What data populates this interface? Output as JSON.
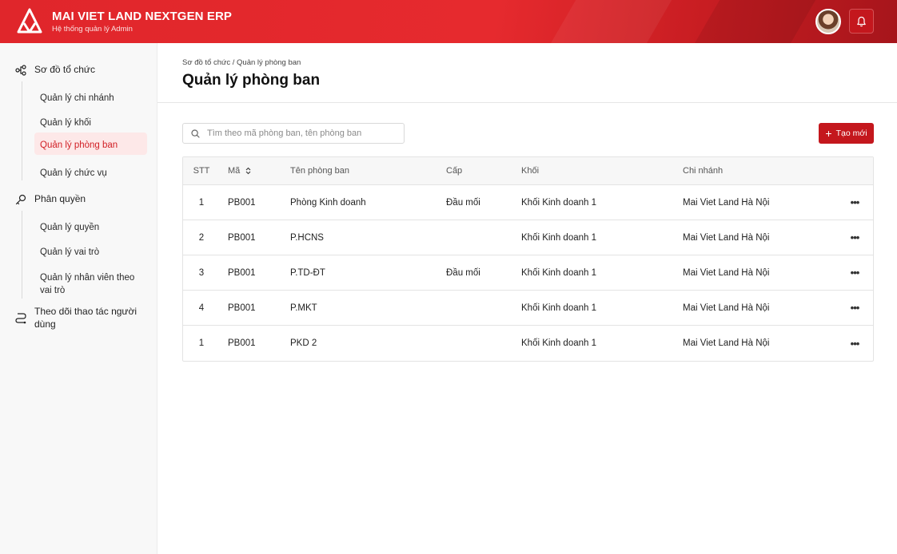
{
  "app": {
    "title": "MAI VIET LAND NEXTGEN ERP",
    "subtitle": "Hệ thống quản lý Admin"
  },
  "sidebar": {
    "groups": [
      {
        "label": "Sơ đồ tổ chức",
        "icon": "org-chart-icon",
        "items": [
          "Quản lý chi nhánh",
          "Quản lý khối",
          "Quản lý phòng ban",
          "Quản lý chức vụ"
        ]
      },
      {
        "label": "Phân quyền",
        "icon": "key-icon",
        "items": [
          "Quản lý quyền",
          "Quản lý vai trò",
          "Quản lý nhân viên theo vai trò"
        ]
      },
      {
        "label": "Theo dõi thao tác người dùng",
        "icon": "route-icon",
        "items": []
      }
    ],
    "active_item": "Quản lý phòng ban"
  },
  "main": {
    "breadcrumb": "Sơ đồ tổ chức / Quản lý phòng ban",
    "title": "Quản lý phòng ban",
    "search_placeholder": "Tìm theo mã phòng ban, tên phòng ban",
    "create_label": "Tạo mới"
  },
  "table": {
    "columns": [
      "STT",
      "Mã",
      "Tên phòng ban",
      "Cấp",
      "Khối",
      "Chi nhánh"
    ],
    "rows": [
      {
        "stt": "1",
        "ma": "PB001",
        "ten": "Phòng Kinh doanh",
        "cap": "Đầu mối",
        "khoi": "Khối Kinh doanh 1",
        "chi_nhanh": "Mai Viet Land Hà Nội"
      },
      {
        "stt": "2",
        "ma": "PB001",
        "ten": "P.HCNS",
        "cap": "",
        "khoi": "Khối Kinh doanh 1",
        "chi_nhanh": "Mai Viet Land Hà Nội"
      },
      {
        "stt": "3",
        "ma": "PB001",
        "ten": "P.TD-ĐT",
        "cap": "Đầu mối",
        "khoi": "Khối Kinh doanh 1",
        "chi_nhanh": "Mai Viet Land Hà Nội"
      },
      {
        "stt": "4",
        "ma": "PB001",
        "ten": "P.MKT",
        "cap": "",
        "khoi": "Khối Kinh doanh 1",
        "chi_nhanh": "Mai Viet Land Hà Nội"
      },
      {
        "stt": "1",
        "ma": "PB001",
        "ten": "PKD 2",
        "cap": "",
        "khoi": "Khối Kinh doanh 1",
        "chi_nhanh": "Mai Viet Land Hà Nội"
      }
    ],
    "row_action_icon": "more-horizontal-icon"
  },
  "colors": {
    "brand": "#e0262b",
    "brand_dark": "#c4171d",
    "active_bg": "#fde8e8"
  }
}
